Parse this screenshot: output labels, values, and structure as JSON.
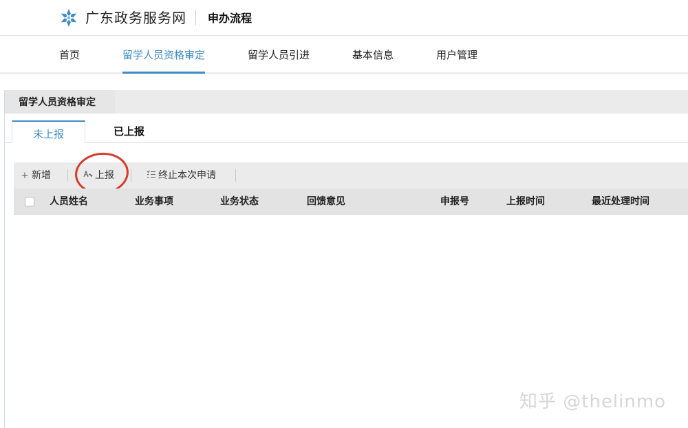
{
  "header": {
    "site_title": "广东政务服务网",
    "subtitle": "申办流程",
    "logo_icon": "snowflake-logo-icon",
    "brand_color": "#3c8cc8"
  },
  "nav": {
    "items": [
      {
        "label": "首页"
      },
      {
        "label": "留学人员资格审定",
        "active": true
      },
      {
        "label": "留学人员引进"
      },
      {
        "label": "基本信息"
      },
      {
        "label": "用户管理"
      }
    ]
  },
  "panel": {
    "title": "留学人员资格审定"
  },
  "tabs": [
    {
      "label": "未上报",
      "active": true
    },
    {
      "label": "已上报"
    }
  ],
  "toolbar": {
    "add_label": "新增",
    "add_icon": "plus-icon",
    "report_label": "上报",
    "report_icon": "signature-icon",
    "terminate_label": "终止本次申请",
    "terminate_icon": "list-check-icon"
  },
  "table": {
    "columns": [
      "人员姓名",
      "业务事项",
      "业务状态",
      "回馈意见",
      "申报号",
      "上报时间",
      "最近处理时间"
    ],
    "rows": []
  },
  "watermark": "知乎 @thelinmo",
  "annotation_color": "#d83a2a"
}
